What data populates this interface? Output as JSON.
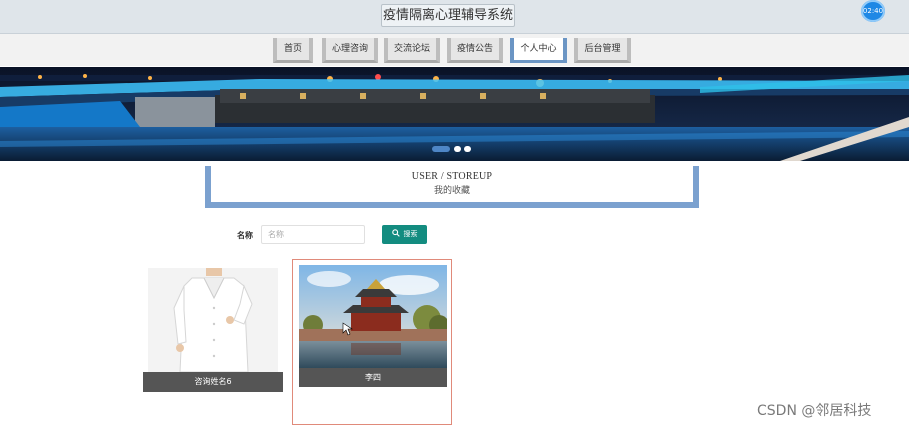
{
  "header": {
    "title": "疫情隔离心理辅导系统",
    "clock": "02:40"
  },
  "nav": {
    "items": [
      {
        "label": "首页",
        "active": false
      },
      {
        "label": "心理咨询",
        "active": false
      },
      {
        "label": "交流论坛",
        "active": false
      },
      {
        "label": "疫情公告",
        "active": false
      },
      {
        "label": "个人中心",
        "active": true
      },
      {
        "label": "后台管理",
        "active": false
      }
    ]
  },
  "banner": {
    "active_slide": 1,
    "slide_count": 3
  },
  "section": {
    "title_en": "USER / STOREUP",
    "title_cn": "我的收藏"
  },
  "search": {
    "label": "名称",
    "placeholder": "名称",
    "value": "",
    "button_label": "搜索"
  },
  "favorites": [
    {
      "caption": "咨询姓名6",
      "image": "doctor-in-white-coat"
    },
    {
      "caption": "李四",
      "image": "forbidden-city-corner-tower"
    }
  ],
  "watermark": "CSDN @邻居科技",
  "colors": {
    "nav_active": "#6b95c4",
    "search_button": "#138c80",
    "card_caption_bg": "#555555",
    "selected_card_border": "#e08a7a"
  }
}
